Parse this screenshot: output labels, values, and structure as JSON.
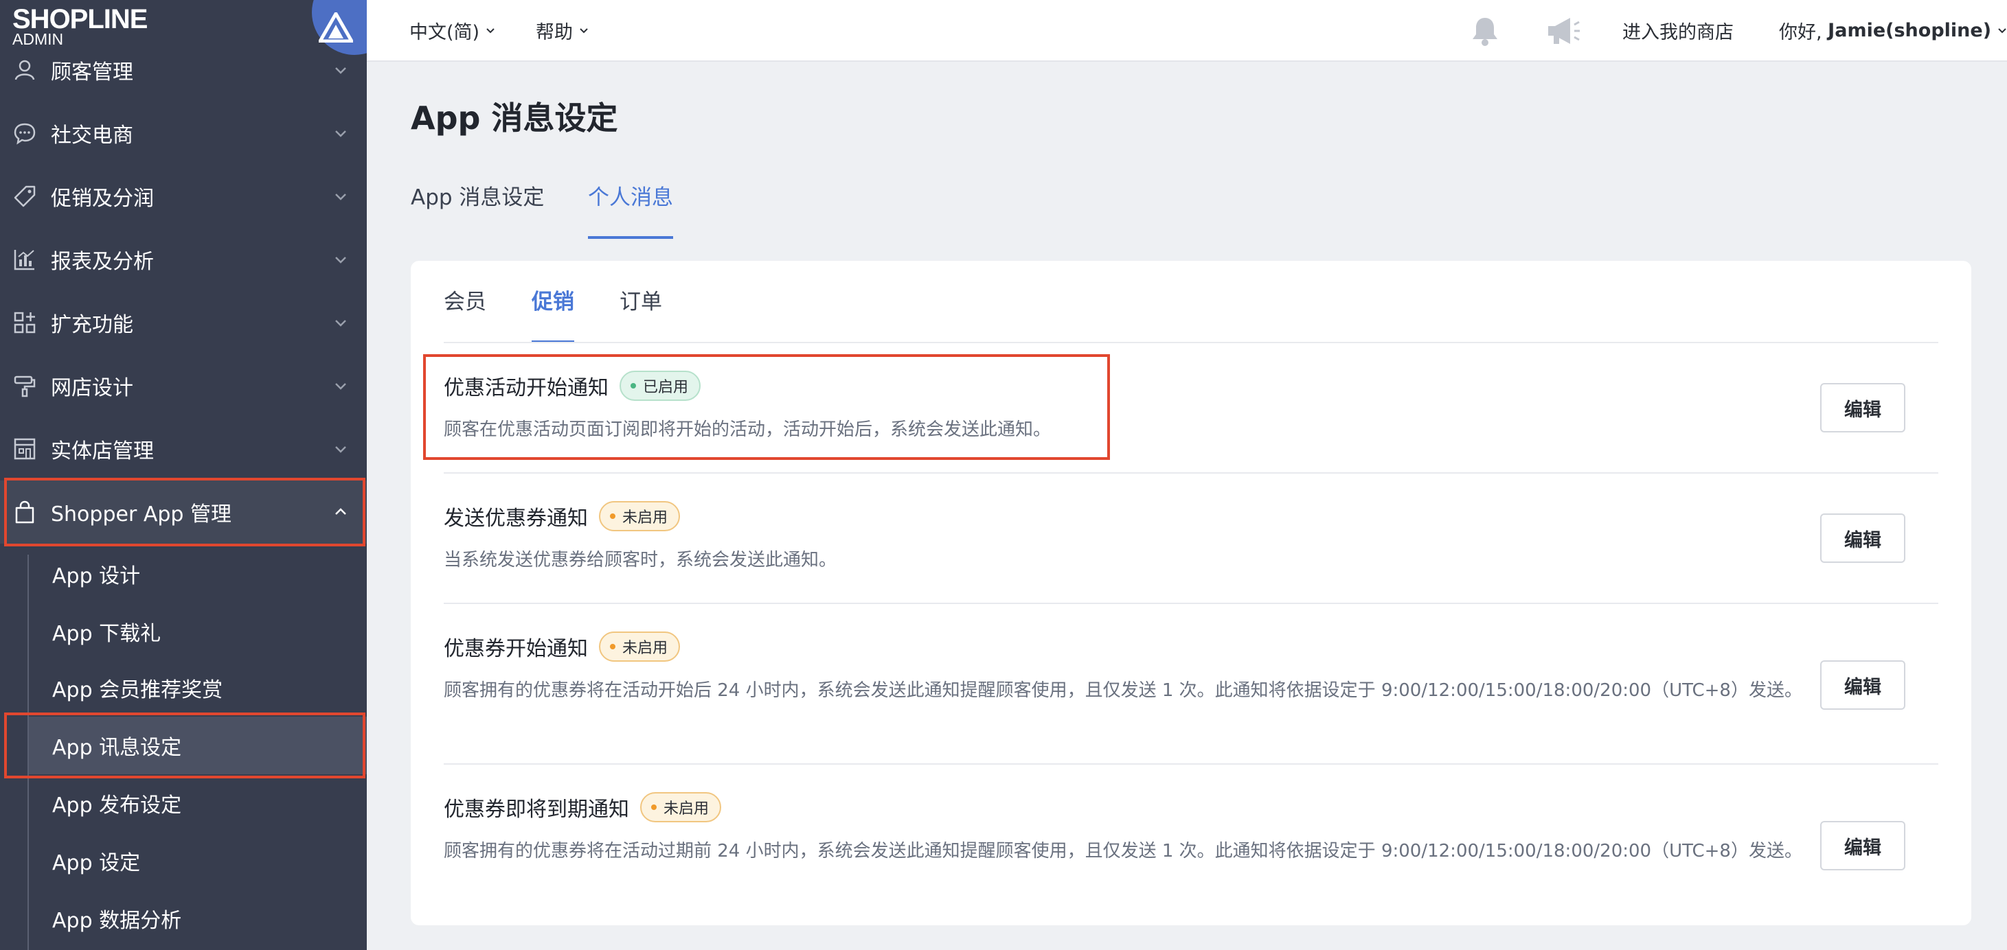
{
  "app": {
    "logo_text": "SHOPLINE",
    "logo_sub": "ADMIN"
  },
  "sidebar": {
    "items": [
      {
        "label": "顾客管理",
        "icon": "user-icon"
      },
      {
        "label": "社交电商",
        "icon": "chat-bubble-icon"
      },
      {
        "label": "促销及分润",
        "icon": "tag-icon"
      },
      {
        "label": "报表及分析",
        "icon": "chart-icon"
      },
      {
        "label": "扩充功能",
        "icon": "apps-icon"
      },
      {
        "label": "网店设计",
        "icon": "paint-roller-icon"
      },
      {
        "label": "实体店管理",
        "icon": "store-icon"
      },
      {
        "label": "Shopper App 管理",
        "icon": "shopping-bag-icon"
      }
    ],
    "sub_items": [
      {
        "label": "App 设计"
      },
      {
        "label": "App 下载礼"
      },
      {
        "label": "App 会员推荐奖赏"
      },
      {
        "label": "App 讯息设定"
      },
      {
        "label": "App 发布设定"
      },
      {
        "label": "App 设定"
      },
      {
        "label": "App 数据分析"
      }
    ]
  },
  "topbar": {
    "language": "中文(简)",
    "help": "帮助",
    "store_link": "进入我的商店",
    "greeting_prefix": "你好, ",
    "user_name": "Jamie(shopline)"
  },
  "page": {
    "title": "App 消息设定",
    "tabs": [
      {
        "label": "App 消息设定"
      },
      {
        "label": "个人消息"
      }
    ]
  },
  "card": {
    "sub_tabs": [
      {
        "label": "会员"
      },
      {
        "label": "促销"
      },
      {
        "label": "订单"
      }
    ],
    "edit_label": "编辑",
    "rows": [
      {
        "title": "优惠活动开始通知",
        "status": "已启用",
        "desc": "顾客在优惠活动页面订阅即将开始的活动，活动开始后，系统会发送此通知。"
      },
      {
        "title": "发送优惠券通知",
        "status": "未启用",
        "desc": "当系统发送优惠券给顾客时，系统会发送此通知。"
      },
      {
        "title": "优惠券开始通知",
        "status": "未启用",
        "desc": "顾客拥有的优惠券将在活动开始后 24 小时内，系统会发送此通知提醒顾客使用，且仅发送 1 次。此通知将依据设定于 9:00/12:00/15:00/18:00/20:00（UTC+8）发送。"
      },
      {
        "title": "优惠券即将到期通知",
        "status": "未启用",
        "desc": "顾客拥有的优惠券将在活动过期前 24 小时内，系统会发送此通知提醒顾客使用，且仅发送 1 次。此通知将依据设定于 9:00/12:00/15:00/18:00/20:00（UTC+8）发送。"
      }
    ]
  },
  "colors": {
    "sidebar_bg": "#373d4e",
    "accent": "#4a78d6",
    "highlight": "#e1472f",
    "enabled": "#4bb583",
    "disabled": "#f09a2a"
  }
}
